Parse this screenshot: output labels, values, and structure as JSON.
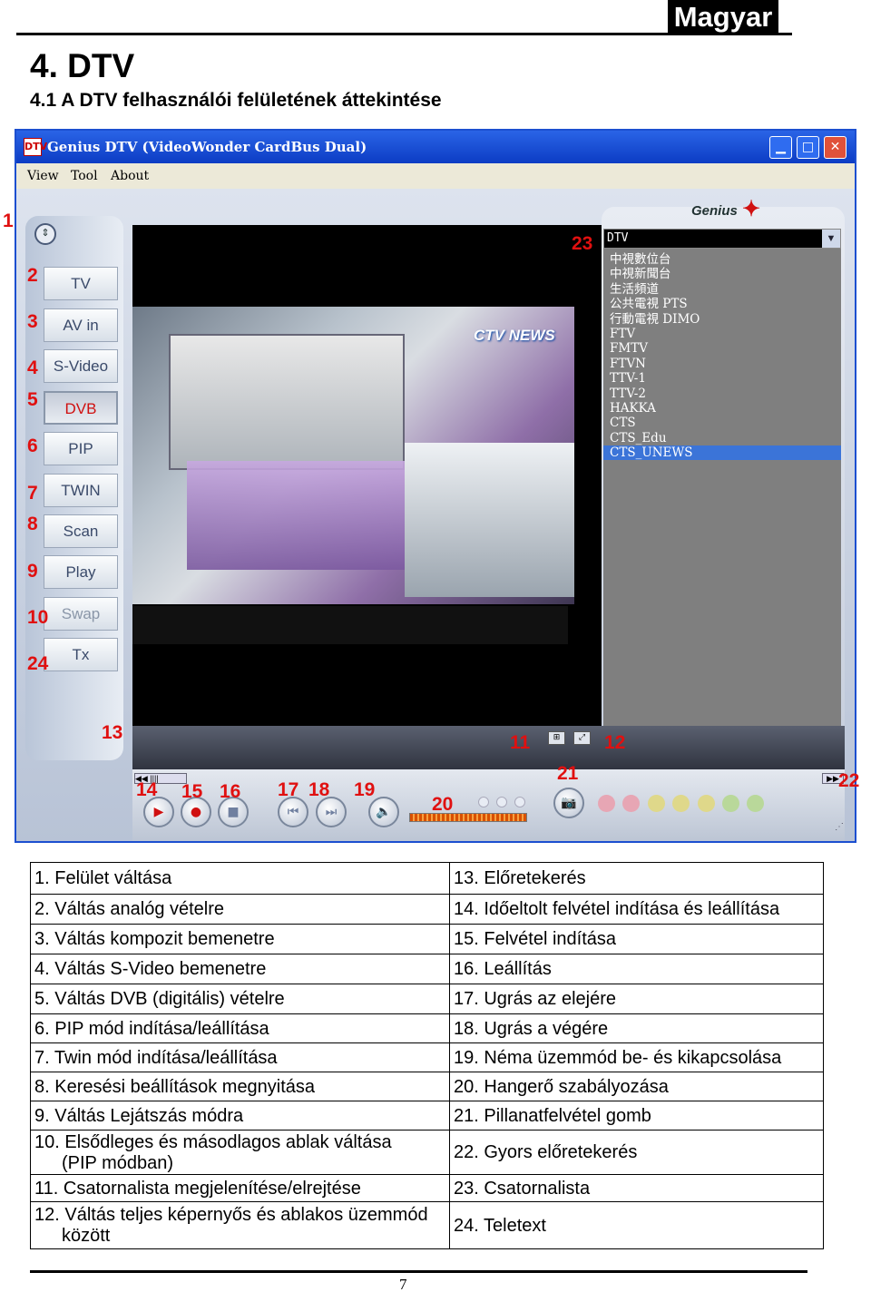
{
  "header": {
    "language": "Magyar",
    "title": "4. DTV",
    "subtitle": "4.1 A DTV felhasználói felületének áttekintése"
  },
  "window": {
    "title": "Genius DTV (VideoWonder CardBus Dual)",
    "menu": [
      "View",
      "Tool",
      "About"
    ],
    "buttons": {
      "minimize": "▁",
      "maximize": "□",
      "close": "✕"
    },
    "side_buttons": [
      {
        "label": "TV"
      },
      {
        "label": "AV in"
      },
      {
        "label": "S-Video"
      },
      {
        "label": "DVB"
      },
      {
        "label": "PIP"
      },
      {
        "label": "TWIN"
      },
      {
        "label": "Scan"
      },
      {
        "label": "Play"
      },
      {
        "label": "Swap"
      },
      {
        "label": "Tx"
      }
    ],
    "brand": "Genius",
    "video_logo": "CTV NEWS",
    "channel_selector": "DTV",
    "channels": [
      "中視數位台",
      "中視新聞台",
      "生活頻道",
      "公共電視 PTS",
      "行動電視 DIMO",
      "FTV",
      "FMTV",
      "FTVN",
      "TTV-1",
      "TTV-2",
      "HAKKA",
      "CTS",
      "CTS_Edu",
      "CTS_UNEWS"
    ],
    "selected_channel_index": 13,
    "callouts": [
      "1",
      "2",
      "3",
      "4",
      "5",
      "6",
      "7",
      "8",
      "9",
      "10",
      "24",
      "13",
      "14",
      "15",
      "16",
      "17",
      "18",
      "19",
      "20",
      "11",
      "12",
      "21",
      "22",
      "23"
    ]
  },
  "legend": [
    [
      "1. Felület váltása",
      "13. Előretekerés"
    ],
    [
      "2. Váltás analóg vételre",
      "14. Időeltolt felvétel indítása és leállítása"
    ],
    [
      "3. Váltás kompozit bemenetre",
      "15. Felvétel indítása"
    ],
    [
      "4. Váltás S-Video bemenetre",
      "16. Leállítás"
    ],
    [
      "5. Váltás DVB (digitális) vételre",
      "17. Ugrás az elejére"
    ],
    [
      "6. PIP mód indítása/leállítása",
      "18. Ugrás a végére"
    ],
    [
      "7. Twin mód indítása/leállítása",
      "19. Néma üzemmód be- és kikapcsolása"
    ],
    [
      "8. Keresési beállítások megnyitása",
      "20. Hangerő szabályozása"
    ],
    [
      "9. Váltás Lejátszás módra",
      "21. Pillanatfelvétel gomb"
    ],
    [
      "10. Elsődleges és másodlagos ablak váltása\n(PIP módban)",
      "22. Gyors előretekerés"
    ],
    [
      "11. Csatornalista megjelenítése/elrejtése",
      "23. Csatornalista"
    ],
    [
      "12. Váltás teljes képernyős és ablakos üzemmód\nközött",
      "24. Teletext"
    ]
  ],
  "page_number": "7"
}
